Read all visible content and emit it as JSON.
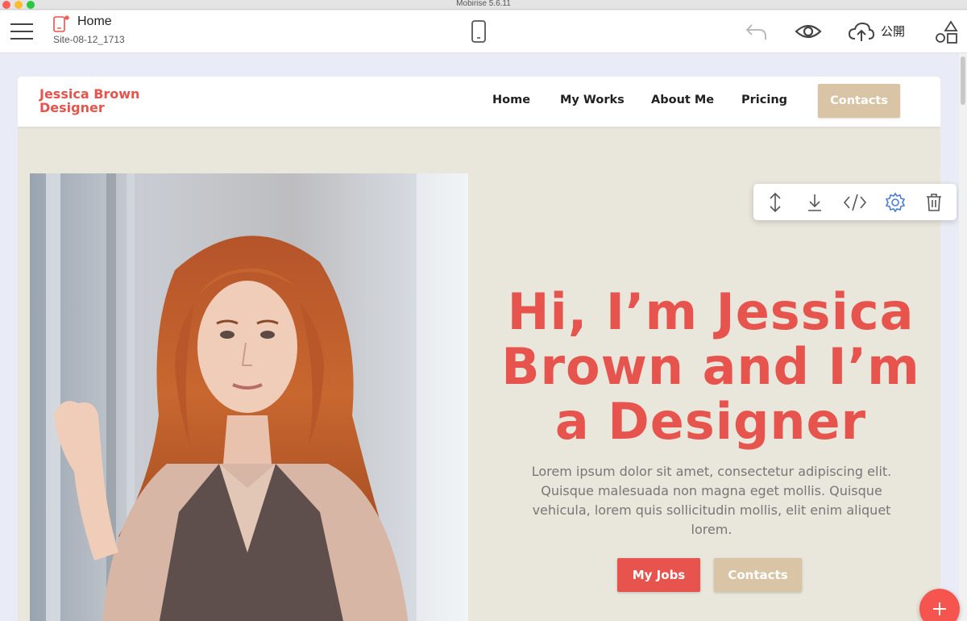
{
  "window": {
    "title": "Mobirise 5.6.11"
  },
  "toolbar": {
    "page_name": "Home",
    "site_name": "Site-08-12_1713",
    "publish_label": "公開"
  },
  "site": {
    "brand_line1": "Jessica Brown",
    "brand_line2": "Designer",
    "nav": [
      {
        "label": "Home"
      },
      {
        "label": "My Works"
      },
      {
        "label": "About Me"
      },
      {
        "label": "Pricing"
      }
    ],
    "nav_button": "Contacts",
    "hero": {
      "title_line1": "Hi, I’m Jessica",
      "title_line2": "Brown and I’m",
      "title_line3": "a Designer",
      "text": "Lorem ipsum dolor sit amet, consectetur adipiscing elit. Quisque malesuada non magna eget mollis. Quisque vehicula, lorem quis sollicitudin mollis, elit enim aliquet lorem.",
      "button_primary": "My Jobs",
      "button_secondary": "Contacts"
    }
  },
  "colors": {
    "accent": "#e7534d",
    "beige": "#d9c5a6",
    "section_bg": "#e9e6dc"
  },
  "icons": {
    "menu": "hamburger-icon",
    "page": "page-icon",
    "mobile": "mobile-preview-icon",
    "undo": "undo-icon",
    "preview": "eye-icon",
    "publish": "cloud-upload-icon",
    "blocks": "shapes-icon",
    "block_tools": [
      "move-icon",
      "download-icon",
      "code-icon",
      "gear-icon",
      "trash-icon"
    ],
    "add": "plus-icon"
  }
}
